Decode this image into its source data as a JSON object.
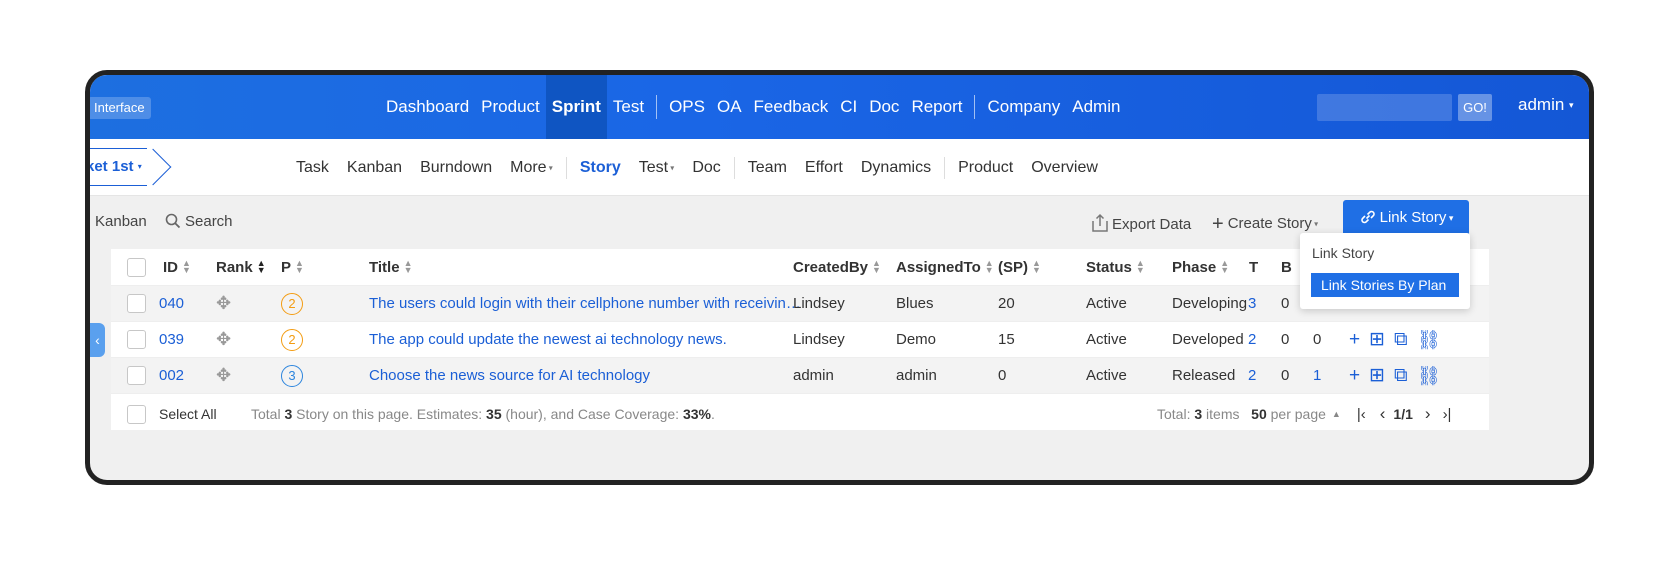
{
  "app": {
    "brand": "Interface",
    "nav": [
      "Dashboard",
      "Product",
      "Sprint",
      "Test",
      "OPS",
      "OA",
      "Feedback",
      "CI",
      "Doc",
      "Report",
      "Company",
      "Admin"
    ],
    "active_nav": "Sprint",
    "go_label": "GO!",
    "user": "admin"
  },
  "subbar": {
    "breadcrumb": "ket 1st",
    "items": [
      "Task",
      "Kanban",
      "Burndown",
      "More",
      "Story",
      "Test",
      "Doc",
      "Team",
      "Effort",
      "Dynamics",
      "Product",
      "Overview"
    ],
    "active": "Story"
  },
  "toolbar": {
    "kanban": "Kanban",
    "search": "Search",
    "export": "Export Data",
    "create": "Create Story",
    "link": "Link Story"
  },
  "dropdown": {
    "items": [
      "Link Story",
      "Link Stories By Plan"
    ],
    "selected": "Link Stories By Plan"
  },
  "table": {
    "headers": {
      "id": "ID",
      "rank": "Rank",
      "p": "P",
      "title": "Title",
      "created": "CreatedBy",
      "assigned": "AssignedTo",
      "sp": "(SP)",
      "status": "Status",
      "phase": "Phase",
      "t": "T",
      "b": "B"
    },
    "rows": [
      {
        "id": "040",
        "p": "2",
        "title": "The users could login with their cellphone number with receivin…",
        "created": "Lindsey",
        "assigned": "Blues",
        "sp": "20",
        "status": "Active",
        "phase": "Developing",
        "t": "3",
        "b": "0",
        "c": ""
      },
      {
        "id": "039",
        "p": "2",
        "title": "The app could update the newest ai technology news.",
        "created": "Lindsey",
        "assigned": "Demo",
        "sp": "15",
        "status": "Active",
        "phase": "Developed",
        "t": "2",
        "b": "0",
        "c": "0"
      },
      {
        "id": "002",
        "p": "3",
        "title": "Choose the news source for AI technology",
        "created": "admin",
        "assigned": "admin",
        "sp": "0",
        "status": "Active",
        "phase": "Released",
        "t": "2",
        "b": "0",
        "c": "1"
      }
    ],
    "footer": {
      "select_all": "Select All",
      "summary_pre": "Total",
      "story_count": "3",
      "summary_mid": "Story on this page. Estimates:",
      "estimates": "35",
      "summary_hours": "(hour), and Case Coverage:",
      "coverage": "33%",
      "total_pre": "Total:",
      "total_items": "3",
      "total_post": "items",
      "per_page": "50",
      "per_page_label": "per page",
      "page": "1/1"
    }
  },
  "colors": {
    "accent": "#1f6fe5",
    "priority_2": "#f39c12",
    "priority_3": "#2e86de"
  }
}
